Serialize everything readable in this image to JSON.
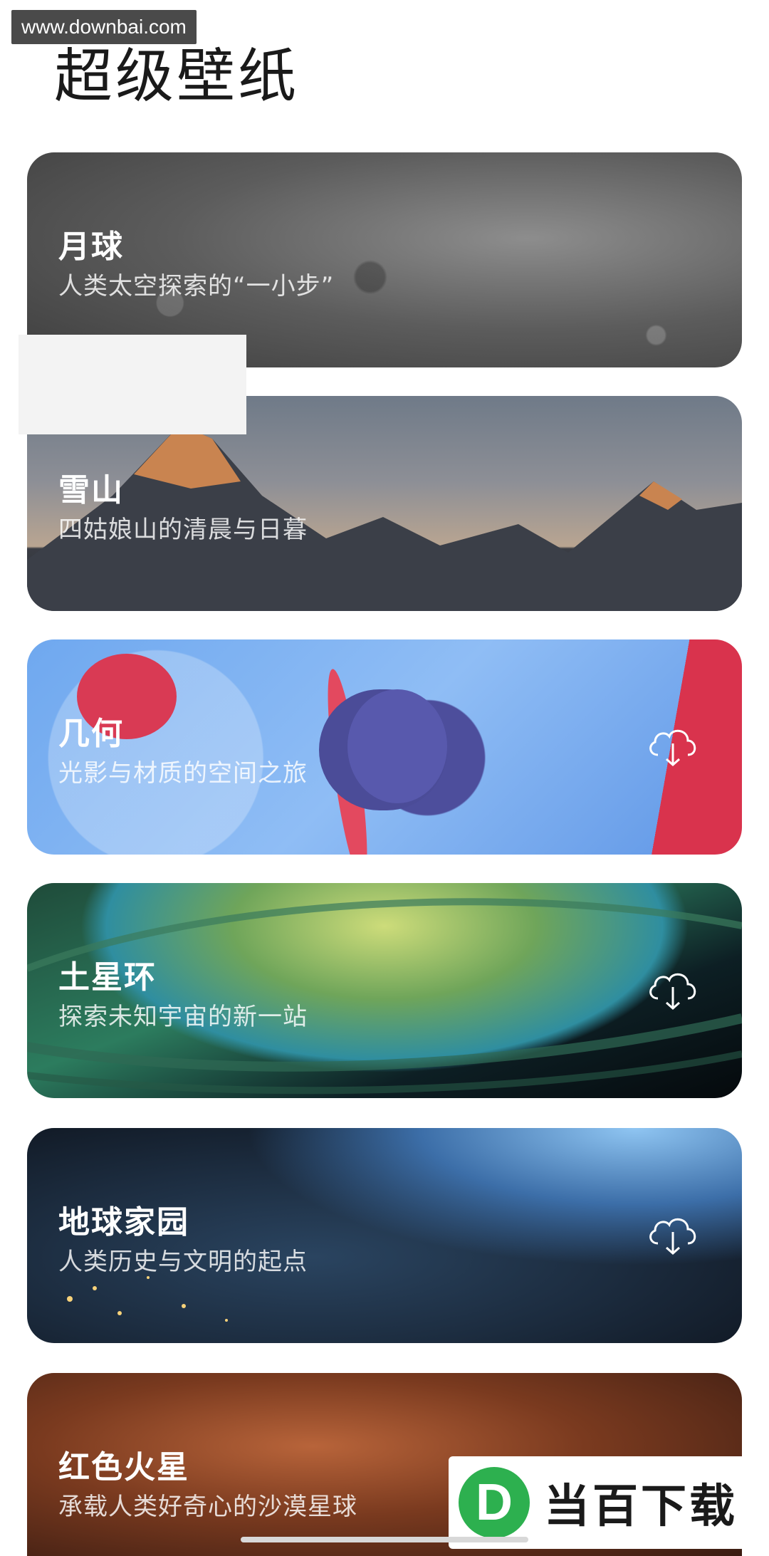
{
  "watermark": "www.downbai.com",
  "page_title": "超级壁纸",
  "cards": [
    {
      "title": "月球",
      "subtitle": "人类太空探索的“一小步”"
    },
    {
      "title": "雪山",
      "subtitle": "四姑娘山的清晨与日暮"
    },
    {
      "title": "几何",
      "subtitle": "光影与材质的空间之旅"
    },
    {
      "title": "土星环",
      "subtitle": "探索未知宇宙的新一站"
    },
    {
      "title": "地球家园",
      "subtitle": "人类历史与文明的起点"
    },
    {
      "title": "红色火星",
      "subtitle": "承载人类好奇心的沙漠星球"
    }
  ],
  "logo": {
    "mark": "D",
    "text": "当百下载"
  },
  "icons": {
    "download": "cloud-download-icon"
  }
}
